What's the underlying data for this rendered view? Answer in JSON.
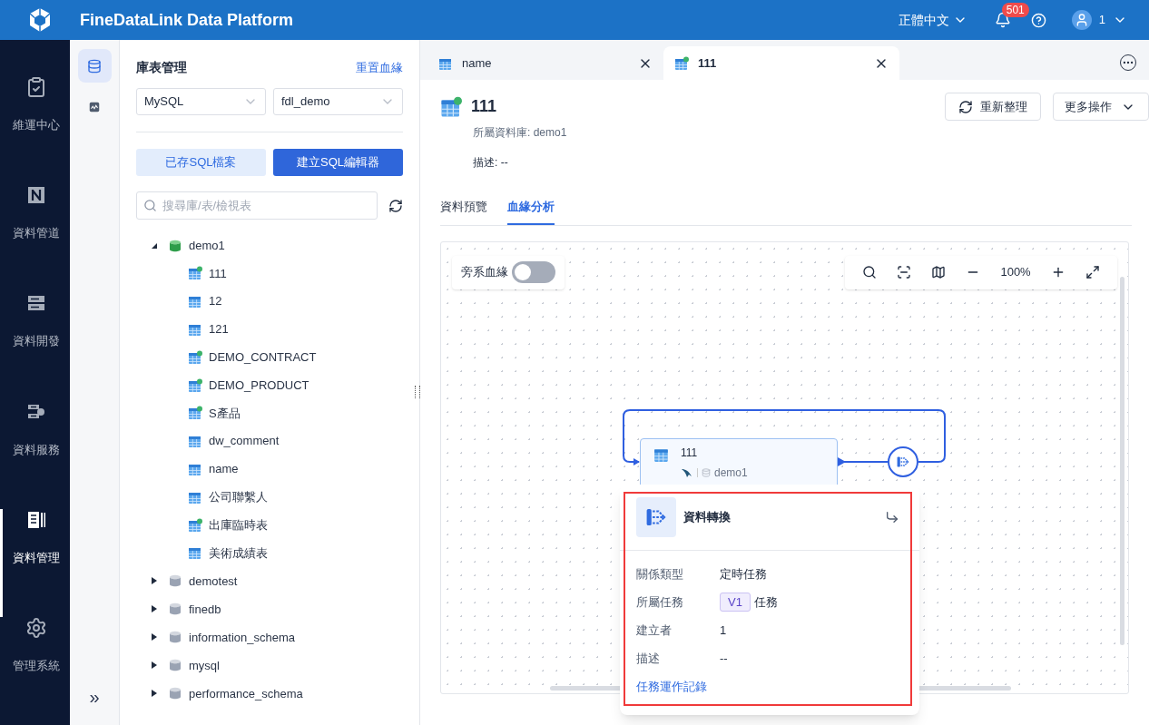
{
  "header": {
    "title": "FineDataLink Data Platform",
    "language": "正體中文",
    "notification_count": "501",
    "user": "1"
  },
  "nav": [
    {
      "label": "維運中心",
      "selected": false
    },
    {
      "label": "資料管道",
      "selected": false
    },
    {
      "label": "資料開發",
      "selected": false
    },
    {
      "label": "資料服務",
      "selected": false
    },
    {
      "label": "資料管理",
      "selected": true
    },
    {
      "label": "管理系統",
      "selected": false
    }
  ],
  "subnav": [
    {
      "selected": true
    },
    {
      "selected": false
    }
  ],
  "collapse_label": "»",
  "panel": {
    "title": "庫表管理",
    "reset_link": "重置血緣",
    "db_type": "MySQL",
    "db_name": "fdl_demo",
    "saved_button": "已存SQL檔案",
    "create_button": "建立SQL編輯器",
    "search_placeholder": "搜尋庫/表/檢視表",
    "tree": [
      {
        "label": "demo1",
        "expanded": true,
        "active": true,
        "children": [
          {
            "label": "111",
            "kind": "synced"
          },
          {
            "label": "12",
            "kind": "table"
          },
          {
            "label": "121",
            "kind": "table"
          },
          {
            "label": "DEMO_CONTRACT",
            "kind": "synced"
          },
          {
            "label": "DEMO_PRODUCT",
            "kind": "synced"
          },
          {
            "label": "S產品",
            "kind": "synced"
          },
          {
            "label": "dw_comment",
            "kind": "table"
          },
          {
            "label": "name",
            "kind": "table"
          },
          {
            "label": "公司聯繫人",
            "kind": "table"
          },
          {
            "label": "出庫臨時表",
            "kind": "synced"
          },
          {
            "label": "美術成績表",
            "kind": "table"
          }
        ]
      },
      {
        "label": "demotest",
        "expanded": false,
        "active": false
      },
      {
        "label": "finedb",
        "expanded": false,
        "active": false
      },
      {
        "label": "information_schema",
        "expanded": false,
        "active": false
      },
      {
        "label": "mysql",
        "expanded": false,
        "active": false
      },
      {
        "label": "performance_schema",
        "expanded": false,
        "active": false
      }
    ]
  },
  "tabs": [
    {
      "label": "name",
      "kind": "table",
      "selected": false
    },
    {
      "label": "111",
      "kind": "synced",
      "selected": true
    }
  ],
  "detail": {
    "title": "111",
    "database_label": "所屬資料庫: demo1",
    "description": "描述: --",
    "refresh_button": "重新整理",
    "more_button": "更多操作",
    "subtabs": [
      {
        "label": "資料預覽",
        "selected": false
      },
      {
        "label": "血緣分析",
        "selected": true
      }
    ]
  },
  "lineage": {
    "side_lineage_label": "旁系血緣",
    "side_lineage_on": false,
    "zoom": "100%",
    "node": {
      "name": "111",
      "database": "demo1"
    },
    "popup": {
      "title": "資料轉換",
      "fields": [
        {
          "label": "關係類型",
          "value": "定時任務"
        },
        {
          "label": "所屬任務",
          "tag": "V1",
          "value": "任務"
        },
        {
          "label": "建立者",
          "value": "1"
        },
        {
          "label": "描述",
          "value": "--"
        }
      ],
      "link": "任務運作記錄"
    }
  }
}
